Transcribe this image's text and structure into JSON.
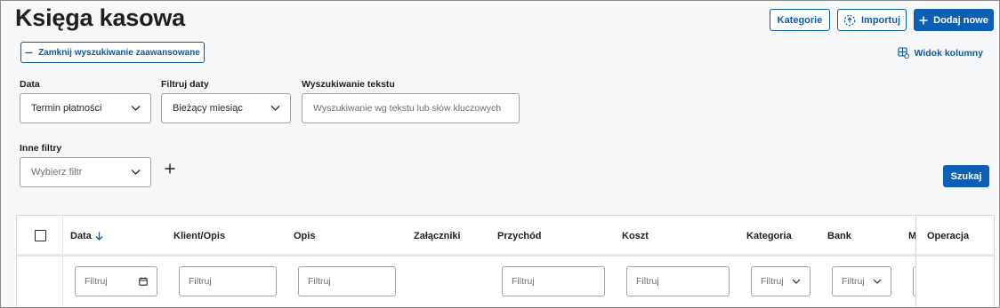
{
  "page": {
    "title": "Księga kasowa"
  },
  "header_actions": {
    "categories_label": "Kategorie",
    "import_label": "Importuj",
    "add_new_label": "Dodaj nowe"
  },
  "search": {
    "close_advanced_label": "Zamknij wyszukiwanie zaawansowane",
    "column_view_label": "Widok kolumny",
    "date_label": "Data",
    "date_value": "Termin płatności",
    "date_filter_label": "Filtruj daty",
    "date_filter_value": "Bieżący miesiąc",
    "text_search_label": "Wyszukiwanie tekstu",
    "text_search_placeholder": "Wyszukiwanie wg tekstu lub słów kluczowych",
    "other_filters_label": "Inne filtry",
    "other_filters_placeholder": "Wybierz filtr",
    "search_button_label": "Szukaj"
  },
  "table": {
    "columns": {
      "date": "Data",
      "client": "Klient/Opis",
      "description": "Opis",
      "attachments": "Załączniki",
      "income": "Przychód",
      "cost": "Koszt",
      "category": "Kategoria",
      "bank": "Bank",
      "partial": "M",
      "operation": "Operacja"
    },
    "filter_placeholder": "Filtruj"
  },
  "icons": {
    "minus": "minus-icon",
    "import": "import-icon",
    "plus": "plus-icon",
    "column_view": "column-view-icon",
    "chevron": "chevron-down-icon",
    "calendar": "calendar-icon",
    "sort": "sort-arrow-down-icon"
  },
  "colors": {
    "accent": "#0d5fb5",
    "link": "#0d5aa7"
  }
}
